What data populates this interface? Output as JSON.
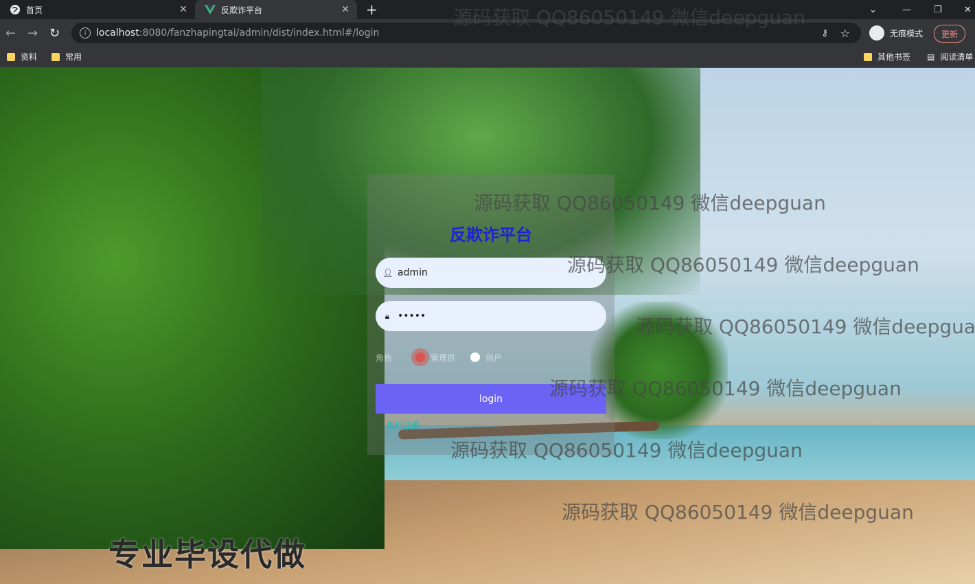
{
  "browser": {
    "tabs": [
      {
        "title": "首页",
        "active": false
      },
      {
        "title": "反欺诈平台",
        "active": true
      }
    ],
    "new_tab": "+",
    "url_host": "localhost",
    "url_rest": ":8080/fanzhapingtai/admin/dist/index.html#/login",
    "incognito_label": "无痕模式",
    "update_label": "更新",
    "bookmarks": [
      "资料",
      "常用"
    ],
    "bookmarks_right": [
      "其他书签",
      "阅读清单"
    ]
  },
  "login": {
    "title": "反欺诈平台",
    "username": "admin",
    "password": "•••••",
    "role_label": "角色",
    "roles": [
      "管理员",
      "用户"
    ],
    "selected_role": 0,
    "button": "login",
    "register_link": "用户注册"
  },
  "overlay": {
    "promo": "专业毕设代做",
    "watermark": "源码获取 QQ86050149 微信deepguan"
  },
  "colors": {
    "title": "#2020d8",
    "button": "#6a63f3",
    "link": "#1db8b8",
    "radio_selected": "#d9534f"
  }
}
